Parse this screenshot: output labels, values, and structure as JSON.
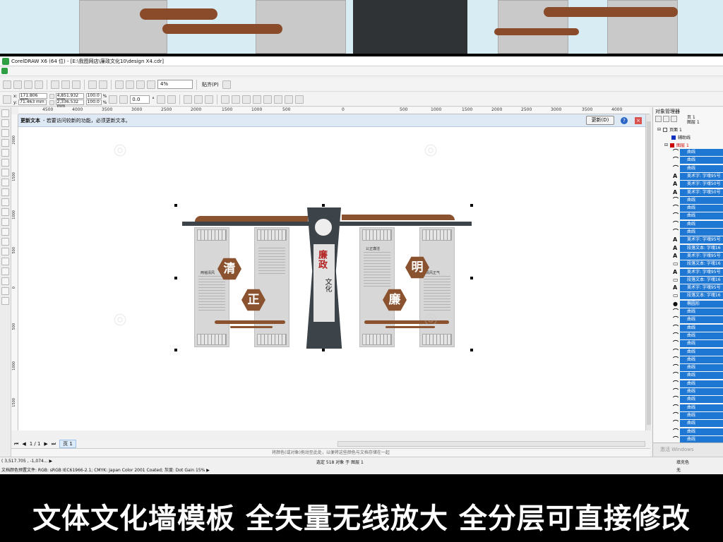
{
  "window": {
    "title": "CorelDRAW X6 (64 位) - [E:\\我图网店\\廉政文化10\\design X4.cdr]"
  },
  "toolbar": {
    "zoom_value": "4%",
    "snap_label": "贴齐(P)"
  },
  "propbar": {
    "x_label": "x:",
    "x_value": "171.806 mm",
    "y_label": "y:",
    "y_value": "71.463 mm",
    "w_value": "4,851.932 mm",
    "h_value": "2,336.532 mm",
    "sx_value": "100.0",
    "sy_value": "100.0",
    "pct": "%",
    "angle_value": "0.0",
    "angle_unit": "°"
  },
  "ruler": {
    "top_ticks": [
      "4500",
      "4000",
      "3500",
      "3000",
      "2500",
      "2000",
      "1500",
      "1000",
      "500",
      "0",
      "500",
      "1000",
      "1500",
      "2000",
      "2500",
      "3000",
      "3500",
      "4000"
    ],
    "left_ticks": [
      "2000",
      "1500",
      "1000",
      "500",
      "0",
      "500",
      "1000",
      "1500"
    ]
  },
  "notify": {
    "title": "更新文本",
    "message": "- 若要访问较新的功能，必须更新文本。",
    "update_button": "更新(D)",
    "help": "?",
    "close": "×"
  },
  "artwork": {
    "hex_chars": [
      "清",
      "正",
      "明",
      "廉"
    ],
    "column_title": "廉政",
    "column_sub": "文化",
    "panel_titles": [
      "两袖清风",
      "公正廉洁",
      "清风正气"
    ]
  },
  "pagebar": {
    "page_count": "1 / 1",
    "page_tab": "页 1"
  },
  "palette_hint": "将颜色(或对象)拖动至此处，以便将这些颜色与文档存储在一起",
  "status": {
    "coords": "( 3,517.705 , -1,074... ▶",
    "selection": "选定 518 对象 于 图层 1",
    "color_profile": "文档颜色预置文件: RGB: sRGB IEC61966-2.1; CMYK: Japan Color 2001 Coated; 灰度: Dot Gain 15% ▶",
    "fill_label": "填充色",
    "outline_label": "无"
  },
  "object_manager": {
    "title": "对象管理器",
    "page_info_1": "页 1",
    "page_info_2": "图层 1",
    "tree_page": "页面 1",
    "guides_layer": "辅助线",
    "layer1": "图层 1",
    "objects": [
      {
        "glyph": "⌒",
        "label": "曲线"
      },
      {
        "glyph": "⌒",
        "label": "曲线"
      },
      {
        "glyph": "⌒",
        "label": "曲线"
      },
      {
        "glyph": "A",
        "label": "美术字: 字魂95号"
      },
      {
        "glyph": "A",
        "label": "美术字: 字魂50号"
      },
      {
        "glyph": "A",
        "label": "美术字: 字魂50号"
      },
      {
        "glyph": "⌒",
        "label": "曲线"
      },
      {
        "glyph": "⌒",
        "label": "曲线"
      },
      {
        "glyph": "⌒",
        "label": "曲线"
      },
      {
        "glyph": "⌒",
        "label": "曲线"
      },
      {
        "glyph": "⌒",
        "label": "曲线"
      },
      {
        "glyph": "A",
        "label": "美术字: 字魂95号"
      },
      {
        "glyph": "A",
        "label": "段落文本: 字魂16"
      },
      {
        "glyph": "A",
        "label": "美术字: 字魂95号"
      },
      {
        "glyph": "▭",
        "label": "段落文本: 字魂16"
      },
      {
        "glyph": "A",
        "label": "美术字: 字魂95号"
      },
      {
        "glyph": "▭",
        "label": "段落文本: 字魂16"
      },
      {
        "glyph": "A",
        "label": "美术字: 字魂95号"
      },
      {
        "glyph": "▭",
        "label": "段落文本: 字魂16"
      },
      {
        "glyph": "●",
        "label": "椭圆形"
      },
      {
        "glyph": "⌒",
        "label": "曲线"
      },
      {
        "glyph": "⌒",
        "label": "曲线"
      },
      {
        "glyph": "⌒",
        "label": "曲线"
      },
      {
        "glyph": "⌒",
        "label": "曲线"
      },
      {
        "glyph": "⌒",
        "label": "曲线"
      },
      {
        "glyph": "⌒",
        "label": "曲线"
      },
      {
        "glyph": "⌒",
        "label": "曲线"
      },
      {
        "glyph": "⌒",
        "label": "曲线"
      },
      {
        "glyph": "⌒",
        "label": "曲线"
      },
      {
        "glyph": "⌒",
        "label": "曲线"
      },
      {
        "glyph": "⌒",
        "label": "曲线"
      },
      {
        "glyph": "⌒",
        "label": "曲线"
      },
      {
        "glyph": "⌒",
        "label": "曲线"
      },
      {
        "glyph": "⌒",
        "label": "曲线"
      },
      {
        "glyph": "⌒",
        "label": "曲线"
      },
      {
        "glyph": "⌒",
        "label": "曲线"
      },
      {
        "glyph": "⌒",
        "label": "曲线"
      }
    ],
    "footer_watermark": "激活 Windows"
  },
  "caption": "文体文化墙模板  全矢量无线放大  全分层可直接修改",
  "colors": {
    "wood": "#8a522f",
    "column_dark": "#3c4449",
    "selection_blue": "#1f77d4",
    "title_red": "#b11e1e"
  }
}
